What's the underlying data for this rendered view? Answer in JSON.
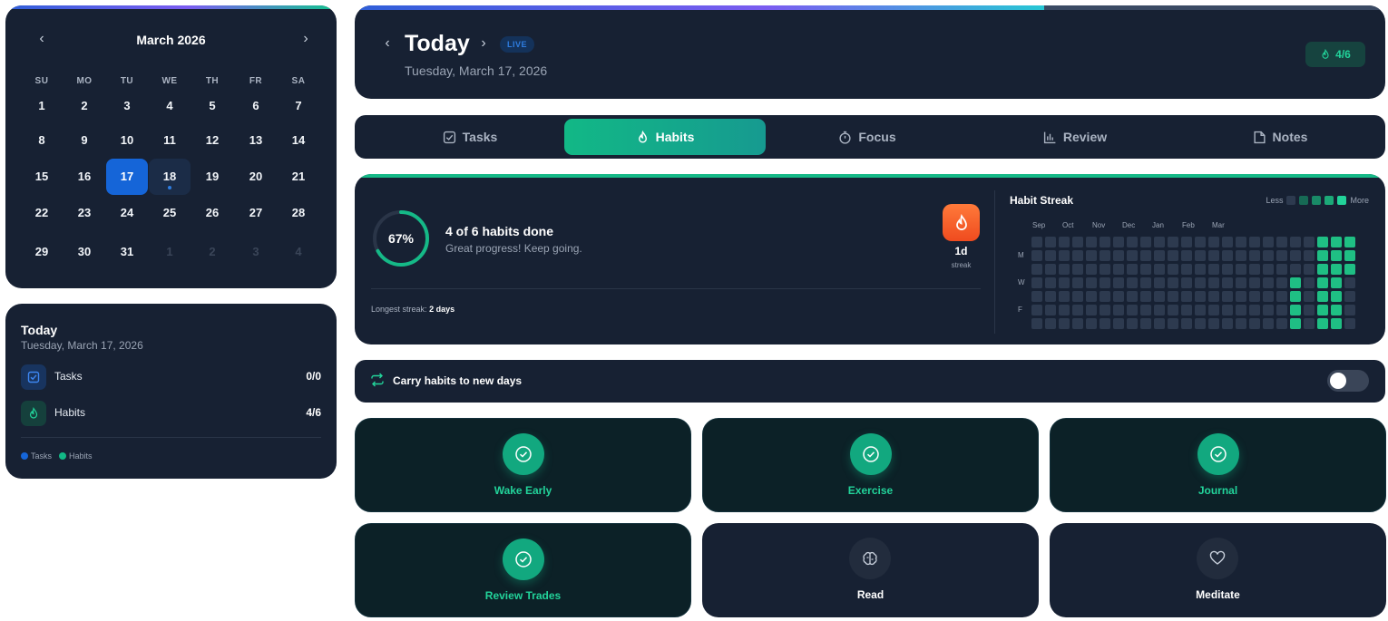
{
  "calendar": {
    "month_title": "March 2026",
    "prev_icon": "chevron-left-icon",
    "next_icon": "chevron-right-icon",
    "weekdays": [
      "SU",
      "MO",
      "TU",
      "WE",
      "TH",
      "FR",
      "SA"
    ],
    "weeks": [
      [
        "1",
        "2",
        "3",
        "4",
        "5",
        "6",
        "7"
      ],
      [
        "8",
        "9",
        "10",
        "11",
        "12",
        "13",
        "14"
      ],
      [
        "15",
        "16",
        "17",
        "18",
        "19",
        "20",
        "21"
      ],
      [
        "22",
        "23",
        "24",
        "25",
        "26",
        "27",
        "28"
      ],
      [
        "29",
        "30",
        "31",
        "1",
        "2",
        "3",
        "4"
      ]
    ],
    "selected_day": "17",
    "highlighted_day": "18",
    "accent": "#1565d8"
  },
  "summary": {
    "title": "Today",
    "date": "Tuesday, March 17, 2026",
    "rows": [
      {
        "label": "Tasks",
        "value": "0/0",
        "icon": "checkbox-icon"
      },
      {
        "label": "Habits",
        "value": "4/6",
        "icon": "flame-icon"
      }
    ],
    "legend": [
      {
        "label": "Tasks",
        "color": "#1565d8"
      },
      {
        "label": "Habits",
        "color": "#12b886"
      }
    ]
  },
  "header": {
    "title": "Today",
    "live_badge": "LIVE",
    "date": "Tuesday, March 17, 2026",
    "badge_value": "4/6",
    "badge_icon": "flame-icon"
  },
  "tabs": [
    {
      "label": "Tasks",
      "icon": "checkbox-icon",
      "active": false
    },
    {
      "label": "Habits",
      "icon": "flame-icon",
      "active": true
    },
    {
      "label": "Focus",
      "icon": "timer-icon",
      "active": false
    },
    {
      "label": "Review",
      "icon": "bar-chart-icon",
      "active": false
    },
    {
      "label": "Notes",
      "icon": "note-icon",
      "active": false
    }
  ],
  "progress": {
    "percent_label": "67%",
    "percent": 67,
    "title": "4 of 6 habits done",
    "subtitle": "Great progress! Keep going.",
    "streak_value": "1d",
    "streak_label": "streak",
    "longest_label": "Longest streak:",
    "longest_value": "2 days"
  },
  "heatmap": {
    "title": "Habit Streak",
    "legend_less": "Less",
    "legend_more": "More",
    "months": [
      "Sep",
      "Oct",
      "Nov",
      "Dec",
      "Jan",
      "Feb",
      "Mar"
    ],
    "weekday_labels": [
      "M",
      "W",
      "F"
    ],
    "weeks": 24,
    "days": 7,
    "active_cells": [
      [
        21,
        0
      ],
      [
        23,
        0
      ],
      [
        22,
        0
      ],
      [
        21,
        1
      ],
      [
        22,
        1
      ],
      [
        23,
        1
      ],
      [
        21,
        2
      ],
      [
        22,
        2
      ],
      [
        23,
        2
      ],
      [
        19,
        3
      ],
      [
        21,
        3
      ],
      [
        22,
        3
      ],
      [
        19,
        4
      ],
      [
        21,
        4
      ],
      [
        22,
        4
      ],
      [
        19,
        5
      ],
      [
        21,
        5
      ],
      [
        22,
        5
      ],
      [
        19,
        6
      ],
      [
        21,
        6
      ],
      [
        22,
        6
      ]
    ],
    "colors": {
      "empty": "#2d3a4f",
      "filled": "#1fbf84"
    }
  },
  "carry": {
    "label": "Carry habits to new days",
    "enabled": false
  },
  "habits": [
    {
      "name": "Wake Early",
      "done": true,
      "icon": "check-circle-icon"
    },
    {
      "name": "Exercise",
      "done": true,
      "icon": "check-circle-icon"
    },
    {
      "name": "Journal",
      "done": true,
      "icon": "check-circle-icon"
    },
    {
      "name": "Review Trades",
      "done": true,
      "icon": "check-circle-icon"
    },
    {
      "name": "Read",
      "done": false,
      "icon": "brain-icon"
    },
    {
      "name": "Meditate",
      "done": false,
      "icon": "heart-icon"
    }
  ]
}
